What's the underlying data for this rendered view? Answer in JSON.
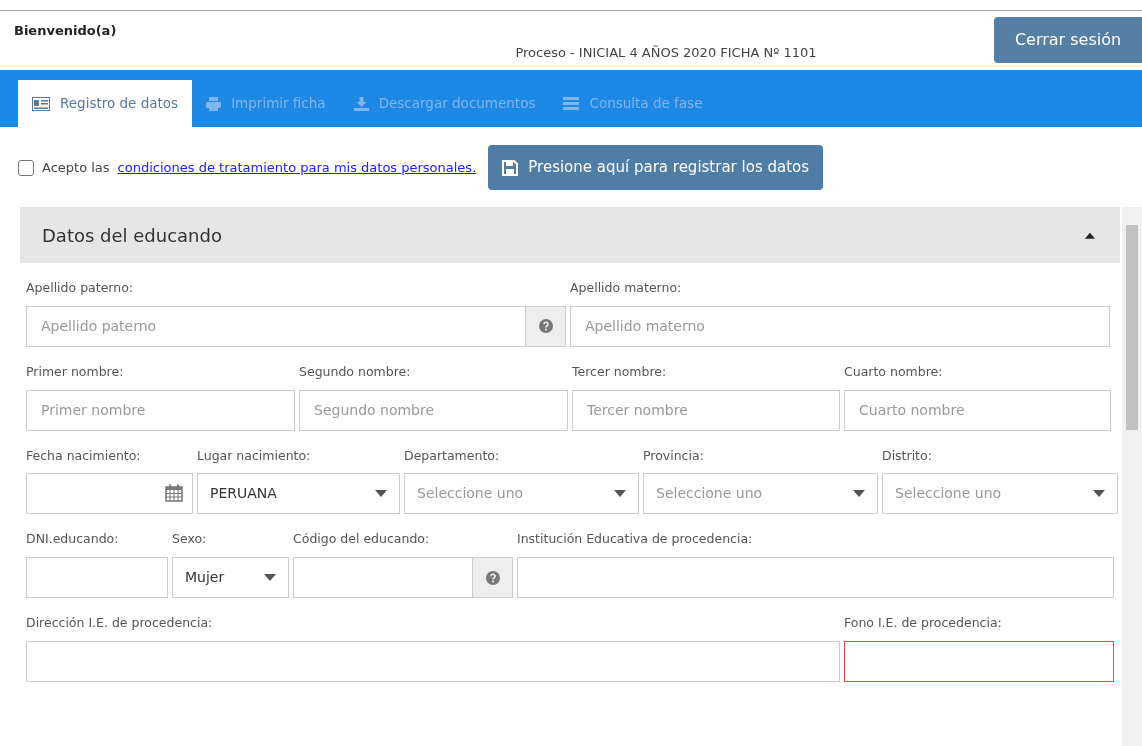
{
  "header": {
    "greeting": "Bienvenido(a)",
    "process": "Proceso - INICIAL 4 AÑOS 2020 FICHA Nº 1101",
    "logout_button": "Cerrar sesión"
  },
  "tabs": [
    {
      "label": "Registro de datos",
      "selected": true,
      "disabled": false
    },
    {
      "label": "Imprimir ficha",
      "selected": false,
      "disabled": true
    },
    {
      "label": "Descargar documentos",
      "selected": false,
      "disabled": true
    },
    {
      "label": "Consulta de fase",
      "selected": false,
      "disabled": true
    }
  ],
  "consent": {
    "checked": false,
    "text": "Acepto las",
    "link": "condiciones de tratamiento para mis datos personales."
  },
  "register_button": "Presione aquí para registrar los datos",
  "section": {
    "title": "Datos del educando",
    "expanded": true,
    "field_lines": [
      {
        "fields": [
          {
            "label": "Apellido paterno:",
            "kind": "help",
            "placeholder": "Apellido paterno"
          },
          {
            "label": "Apellido materno:",
            "kind": "text",
            "placeholder": "Apellido materno"
          }
        ]
      },
      {
        "fields": [
          {
            "label": "Primer nombre:",
            "kind": "text",
            "placeholder": "Primer nombre"
          },
          {
            "label": "Segundo nombre:",
            "kind": "text",
            "placeholder": "Segundo nombre"
          },
          {
            "label": "Tercer nombre:",
            "kind": "text",
            "placeholder": "Tercer nombre"
          },
          {
            "label": "Cuarto nombre:",
            "kind": "text",
            "placeholder": "Cuarto nombre"
          }
        ]
      },
      {
        "fields": [
          {
            "label": "Fecha nacimiento:",
            "kind": "date"
          },
          {
            "label": "Lugar nacimiento:",
            "kind": "select",
            "value": "PERUANA"
          },
          {
            "label": "Departamento:",
            "kind": "select",
            "placeholder": "Seleccione uno"
          },
          {
            "label": "Provincia:",
            "kind": "select",
            "placeholder": "Seleccione uno"
          },
          {
            "label": "Distrito:",
            "kind": "select",
            "placeholder": "Seleccione uno"
          }
        ]
      },
      {
        "fields": [
          {
            "label": "DNI.educando:",
            "kind": "text"
          },
          {
            "label": "Sexo:",
            "kind": "select",
            "value": "Mujer"
          },
          {
            "label": "Código del educando:",
            "kind": "help"
          },
          {
            "label": "Institución Educativa de procedencia:",
            "kind": "text"
          }
        ]
      },
      {
        "fields": [
          {
            "label": "Dirección I.E. de procedencia:",
            "kind": "text"
          },
          {
            "label": "Fono I.E. de procedencia:",
            "kind": "text",
            "invalid": true
          }
        ]
      }
    ]
  }
}
